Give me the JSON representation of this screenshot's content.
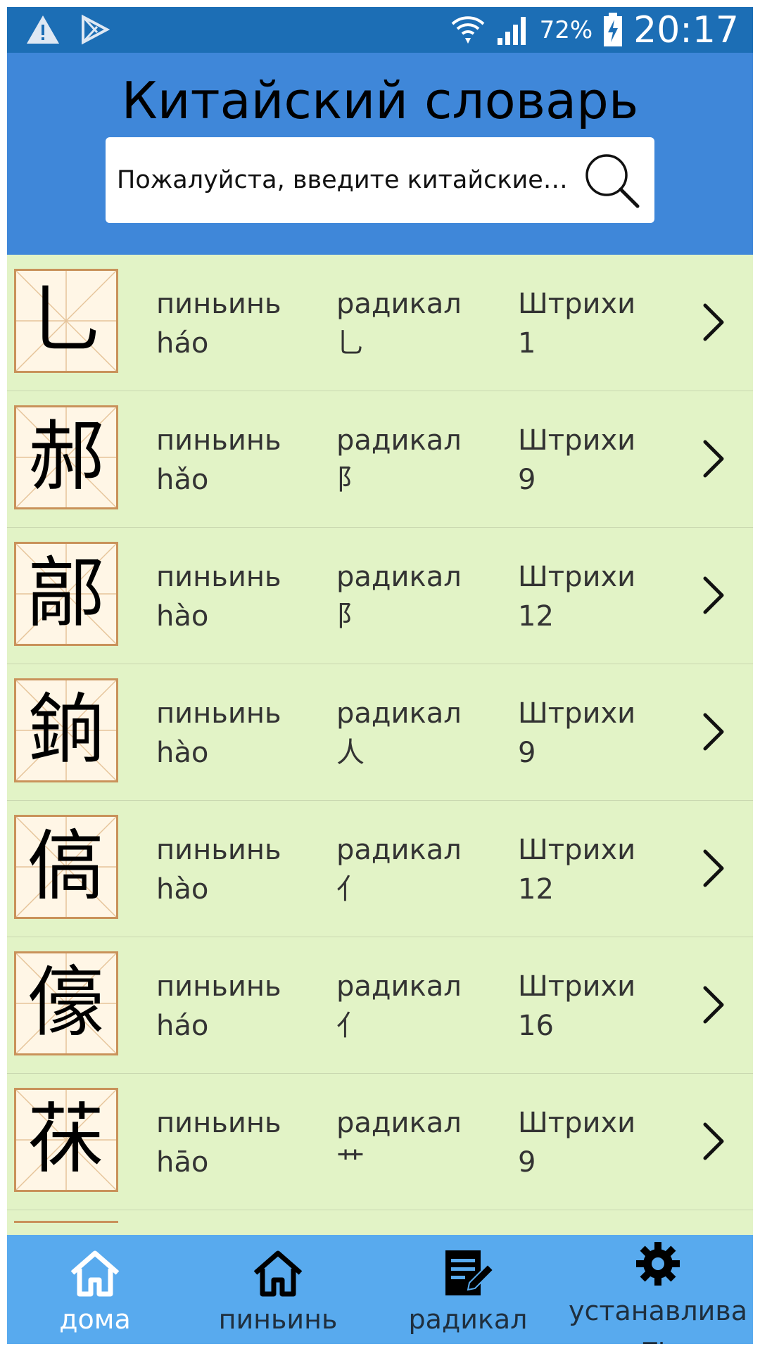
{
  "status_bar": {
    "battery": "72%",
    "time": "20:17"
  },
  "app": {
    "title": "Китайский словарь"
  },
  "search": {
    "placeholder": "Пожалуйста, введите китайские и..."
  },
  "list": {
    "label_pinyin": "пиньинь",
    "label_radical": "радикал",
    "label_strokes": "Штрихи",
    "items": [
      {
        "char": "乚",
        "pinyin": "háo",
        "radical": "乚",
        "strokes": "1"
      },
      {
        "char": "郝",
        "pinyin": "hǎo",
        "radical": "阝",
        "strokes": "9"
      },
      {
        "char": "鄗",
        "pinyin": "hào",
        "radical": "阝",
        "strokes": "12"
      },
      {
        "char": "銄",
        "pinyin": "hào",
        "radical": "人",
        "strokes": "9"
      },
      {
        "char": "傐",
        "pinyin": "hào",
        "radical": "亻",
        "strokes": "12"
      },
      {
        "char": "儫",
        "pinyin": "háo",
        "radical": "亻",
        "strokes": "16"
      },
      {
        "char": "茠",
        "pinyin": "hāo",
        "radical": "艹",
        "strokes": "9"
      }
    ]
  },
  "bottom_nav": {
    "items": [
      {
        "label": "дома",
        "icon": "home-outline-icon",
        "active": true
      },
      {
        "label": "пиньинь",
        "icon": "home-icon"
      },
      {
        "label": "радикал",
        "icon": "edit-note-icon"
      },
      {
        "label": "устанавливать",
        "icon": "gear-icon"
      }
    ]
  },
  "colors": {
    "status_bar": "#1c6eb5",
    "header": "#3f87d9",
    "list_bg": "#e2f3c6",
    "bottom_nav": "#58aaee",
    "char_box_border": "#c9925a"
  }
}
